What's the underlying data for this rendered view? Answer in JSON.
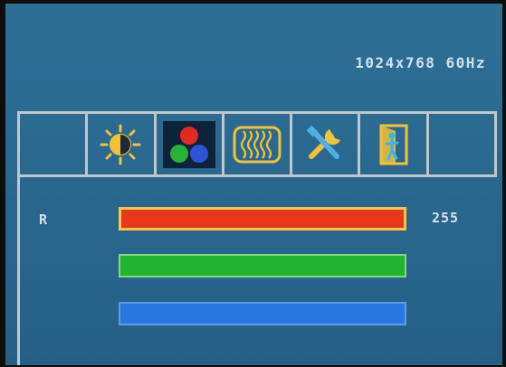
{
  "osd": {
    "resolution": "1024x768 60Hz",
    "tabs": [
      {
        "icon": "blank"
      },
      {
        "icon": "brightness-icon"
      },
      {
        "icon": "color-icon",
        "active": true
      },
      {
        "icon": "image-setup-icon"
      },
      {
        "icon": "tools-icon"
      },
      {
        "icon": "exit-icon"
      },
      {
        "icon": "blank"
      }
    ],
    "color": {
      "r_label": "R",
      "r_value": "255",
      "levels": {
        "red": 1.0,
        "green": 1.0,
        "blue": 1.0
      }
    }
  },
  "colors": {
    "background": "#2a6890",
    "red": "#e8371a",
    "green": "#22b431",
    "blue": "#2878e0",
    "highlight": "#f4c64a"
  }
}
